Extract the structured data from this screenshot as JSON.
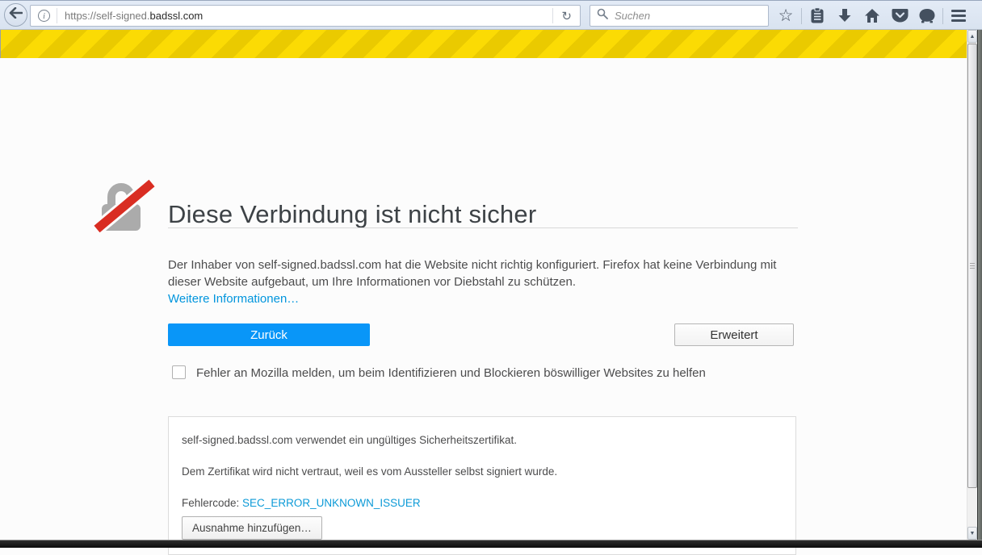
{
  "browser": {
    "url": {
      "prefix": "https://self-signed.",
      "domain": "badssl.com"
    },
    "search": {
      "placeholder": "Suchen"
    }
  },
  "icons": {
    "reload": "↻",
    "star": "☆",
    "scroll_up": "▲",
    "scroll_down": "▼"
  },
  "page": {
    "heading": "Diese Verbindung ist nicht sicher",
    "body": "Der Inhaber von self-signed.badssl.com hat die Website nicht richtig konfiguriert. Firefox hat keine Verbindung mit dieser Website aufgebaut, um Ihre Informationen vor Diebstahl zu schützen.",
    "learn_more": "Weitere Informationen…",
    "back_button": "Zurück",
    "advanced_button": "Erweitert",
    "report_checkbox_label": "Fehler an Mozilla melden, um beim Identifizieren und Blockieren böswilliger Websites zu helfen",
    "cert_box": {
      "line1": "self-signed.badssl.com verwendet ein ungültiges Sicherheitszertifikat.",
      "line2": "Dem Zertifikat wird nicht vertraut, weil es vom Aussteller selbst signiert wurde.",
      "error_label": "Fehlercode: ",
      "error_code": "SEC_ERROR_UNKNOWN_ISSUER",
      "exception_button": "Ausnahme hinzufügen…"
    }
  },
  "colors": {
    "accent_blue": "#0996f8",
    "link_blue": "#0095dd",
    "stripe_light": "#fbdb04",
    "stripe_dark": "#eaca00",
    "toolbar_bg": "#dce5f1",
    "slash_red": "#d92d22",
    "lock_gray": "#ababab"
  }
}
